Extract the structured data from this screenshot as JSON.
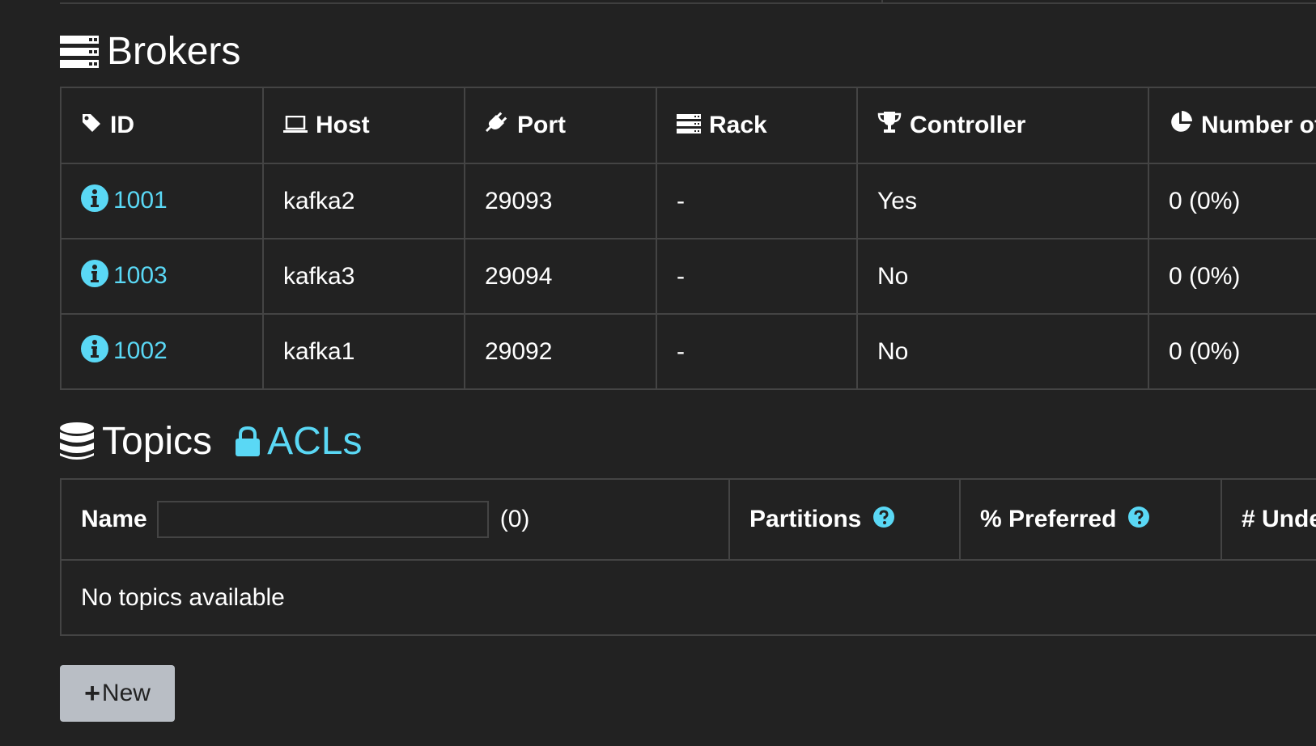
{
  "brokers": {
    "title": "Brokers",
    "headers": {
      "id": "ID",
      "host": "Host",
      "port": "Port",
      "rack": "Rack",
      "controller": "Controller",
      "partitions": "Number of"
    },
    "rows": [
      {
        "id": "1001",
        "host": "kafka2",
        "port": "29093",
        "rack": "-",
        "controller": "Yes",
        "partitions": "0 (0%)"
      },
      {
        "id": "1003",
        "host": "kafka3",
        "port": "29094",
        "rack": "-",
        "controller": "No",
        "partitions": "0 (0%)"
      },
      {
        "id": "1002",
        "host": "kafka1",
        "port": "29092",
        "rack": "-",
        "controller": "No",
        "partitions": "0 (0%)"
      }
    ]
  },
  "topics": {
    "title": "Topics",
    "acls_link": "ACLs",
    "headers": {
      "name": "Name",
      "count": "(0)",
      "partitions": "Partitions",
      "preferred": "% Preferred",
      "under": "# Unde"
    },
    "name_filter": {
      "value": "",
      "placeholder": ""
    },
    "empty_message": "No topics available",
    "new_button": "New"
  },
  "icons": {
    "brokers": "server-icon",
    "id": "tag-icon",
    "host": "laptop-icon",
    "port": "plug-icon",
    "rack": "server-icon",
    "controller": "trophy-icon",
    "partitions": "pie-chart-icon",
    "broker_info": "info-circle-icon",
    "topics": "database-icon",
    "acls": "lock-icon",
    "help": "question-circle-icon",
    "new": "plus-icon"
  },
  "colors": {
    "background": "#222222",
    "accent": "#5ad8f5",
    "border": "#444444",
    "button": "#b9bec5"
  }
}
